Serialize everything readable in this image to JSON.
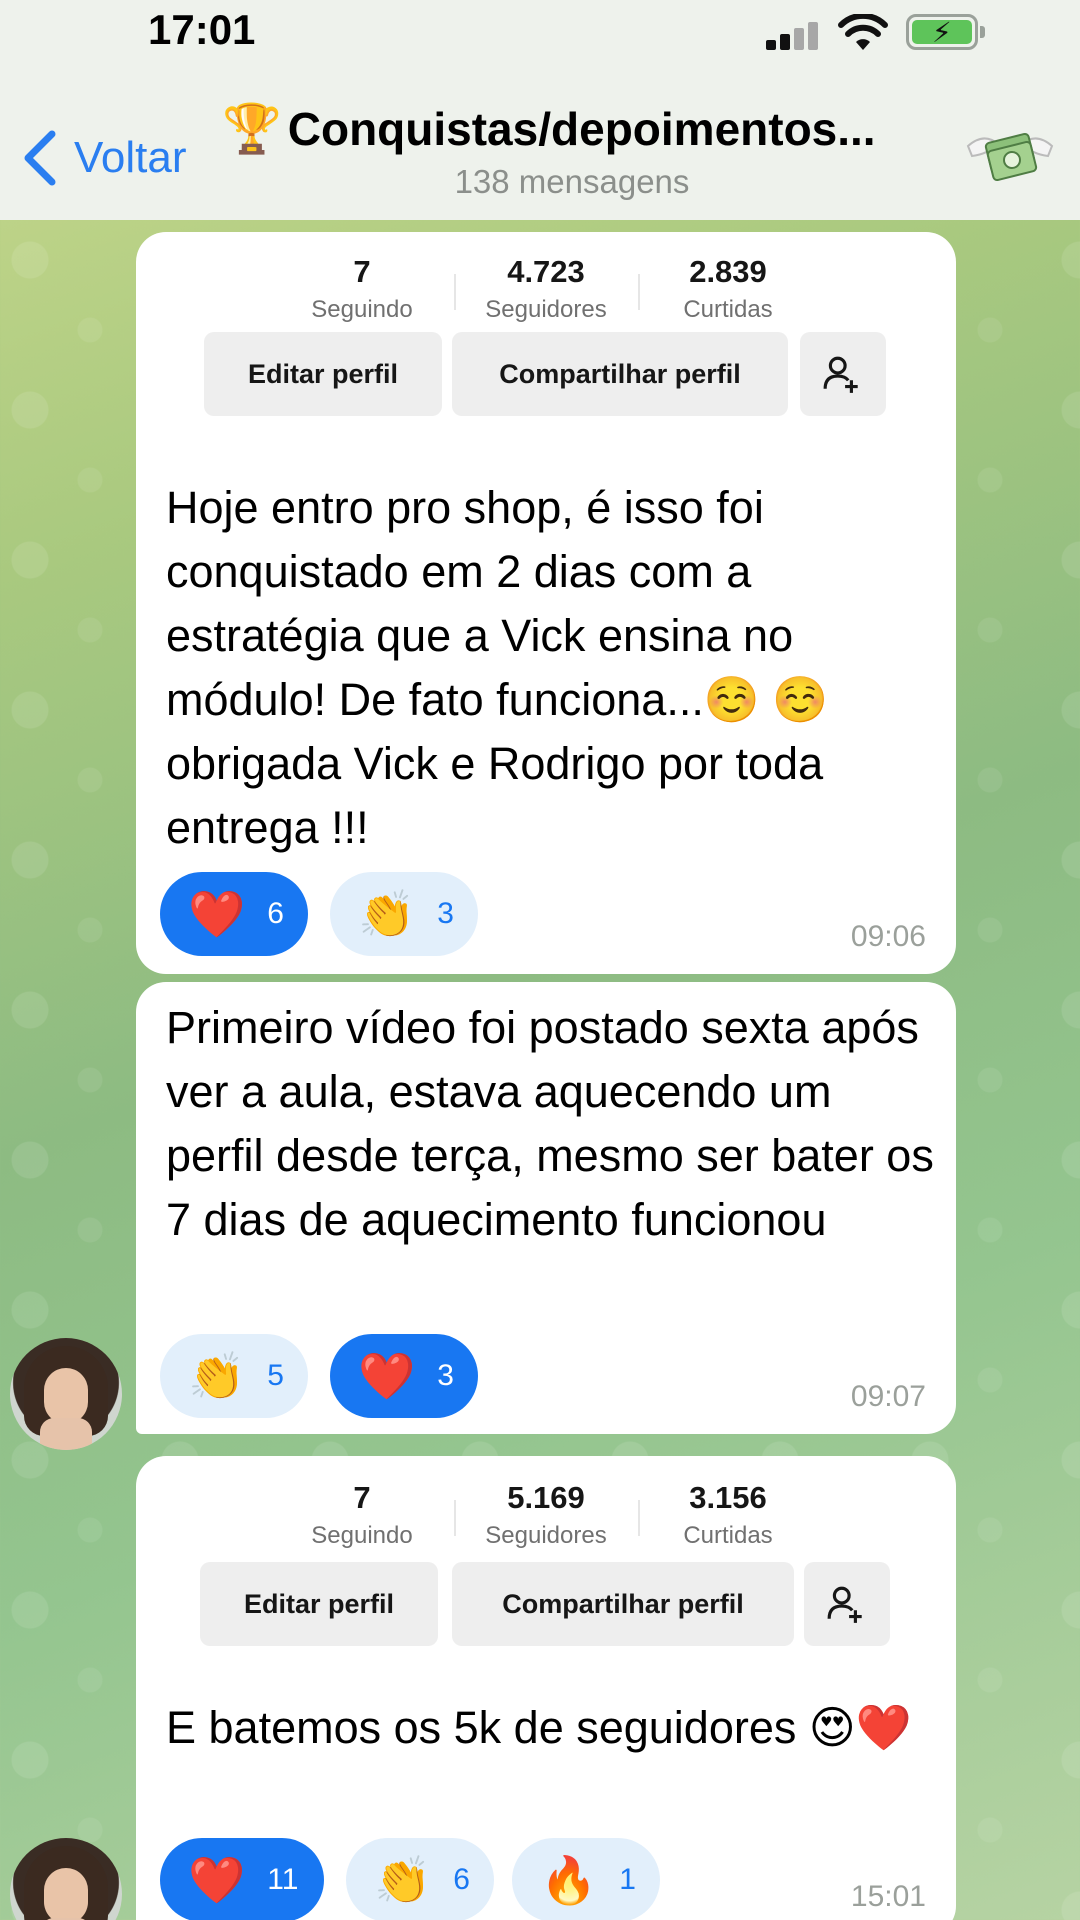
{
  "status_bar": {
    "time": "17:01"
  },
  "header": {
    "back_label": "Voltar",
    "title": "Conquistas/depoimentos...",
    "subtitle": "138 mensagens"
  },
  "messages": [
    {
      "profile": {
        "stats": [
          {
            "num": "7",
            "label": "Seguindo"
          },
          {
            "num": "4.723",
            "label": "Seguidores"
          },
          {
            "num": "2.839",
            "label": "Curtidas"
          }
        ],
        "edit_label": "Editar perfil",
        "share_label": "Compartilhar perfil"
      },
      "text": "Hoje entro pro shop, é isso foi conquistado em 2 dias com a estratégia que a Vick ensina no módulo! De fato funciona...☺️ ☺️ obrigada Vick e Rodrigo por toda entrega !!!",
      "reactions": [
        {
          "emoji": "❤️",
          "count": "6",
          "active": true
        },
        {
          "emoji": "👏",
          "count": "3",
          "active": false
        }
      ],
      "time": "09:06"
    },
    {
      "text": "Primeiro vídeo foi postado sexta após ver a aula, estava aquecendo um perfil desde terça, mesmo ser bater os 7 dias de aquecimento funcionou",
      "reactions": [
        {
          "emoji": "👏",
          "count": "5",
          "active": false
        },
        {
          "emoji": "❤️",
          "count": "3",
          "active": true
        }
      ],
      "time": "09:07"
    },
    {
      "profile": {
        "stats": [
          {
            "num": "7",
            "label": "Seguindo"
          },
          {
            "num": "5.169",
            "label": "Seguidores"
          },
          {
            "num": "3.156",
            "label": "Curtidas"
          }
        ],
        "edit_label": "Editar perfil",
        "share_label": "Compartilhar perfil"
      },
      "text": "E batemos os 5k de seguidores 😍❤️",
      "reactions": [
        {
          "emoji": "❤️",
          "count": "11",
          "active": true
        },
        {
          "emoji": "👏",
          "count": "6",
          "active": false
        },
        {
          "emoji": "🔥",
          "count": "1",
          "active": false
        }
      ],
      "time": "15:01"
    }
  ]
}
